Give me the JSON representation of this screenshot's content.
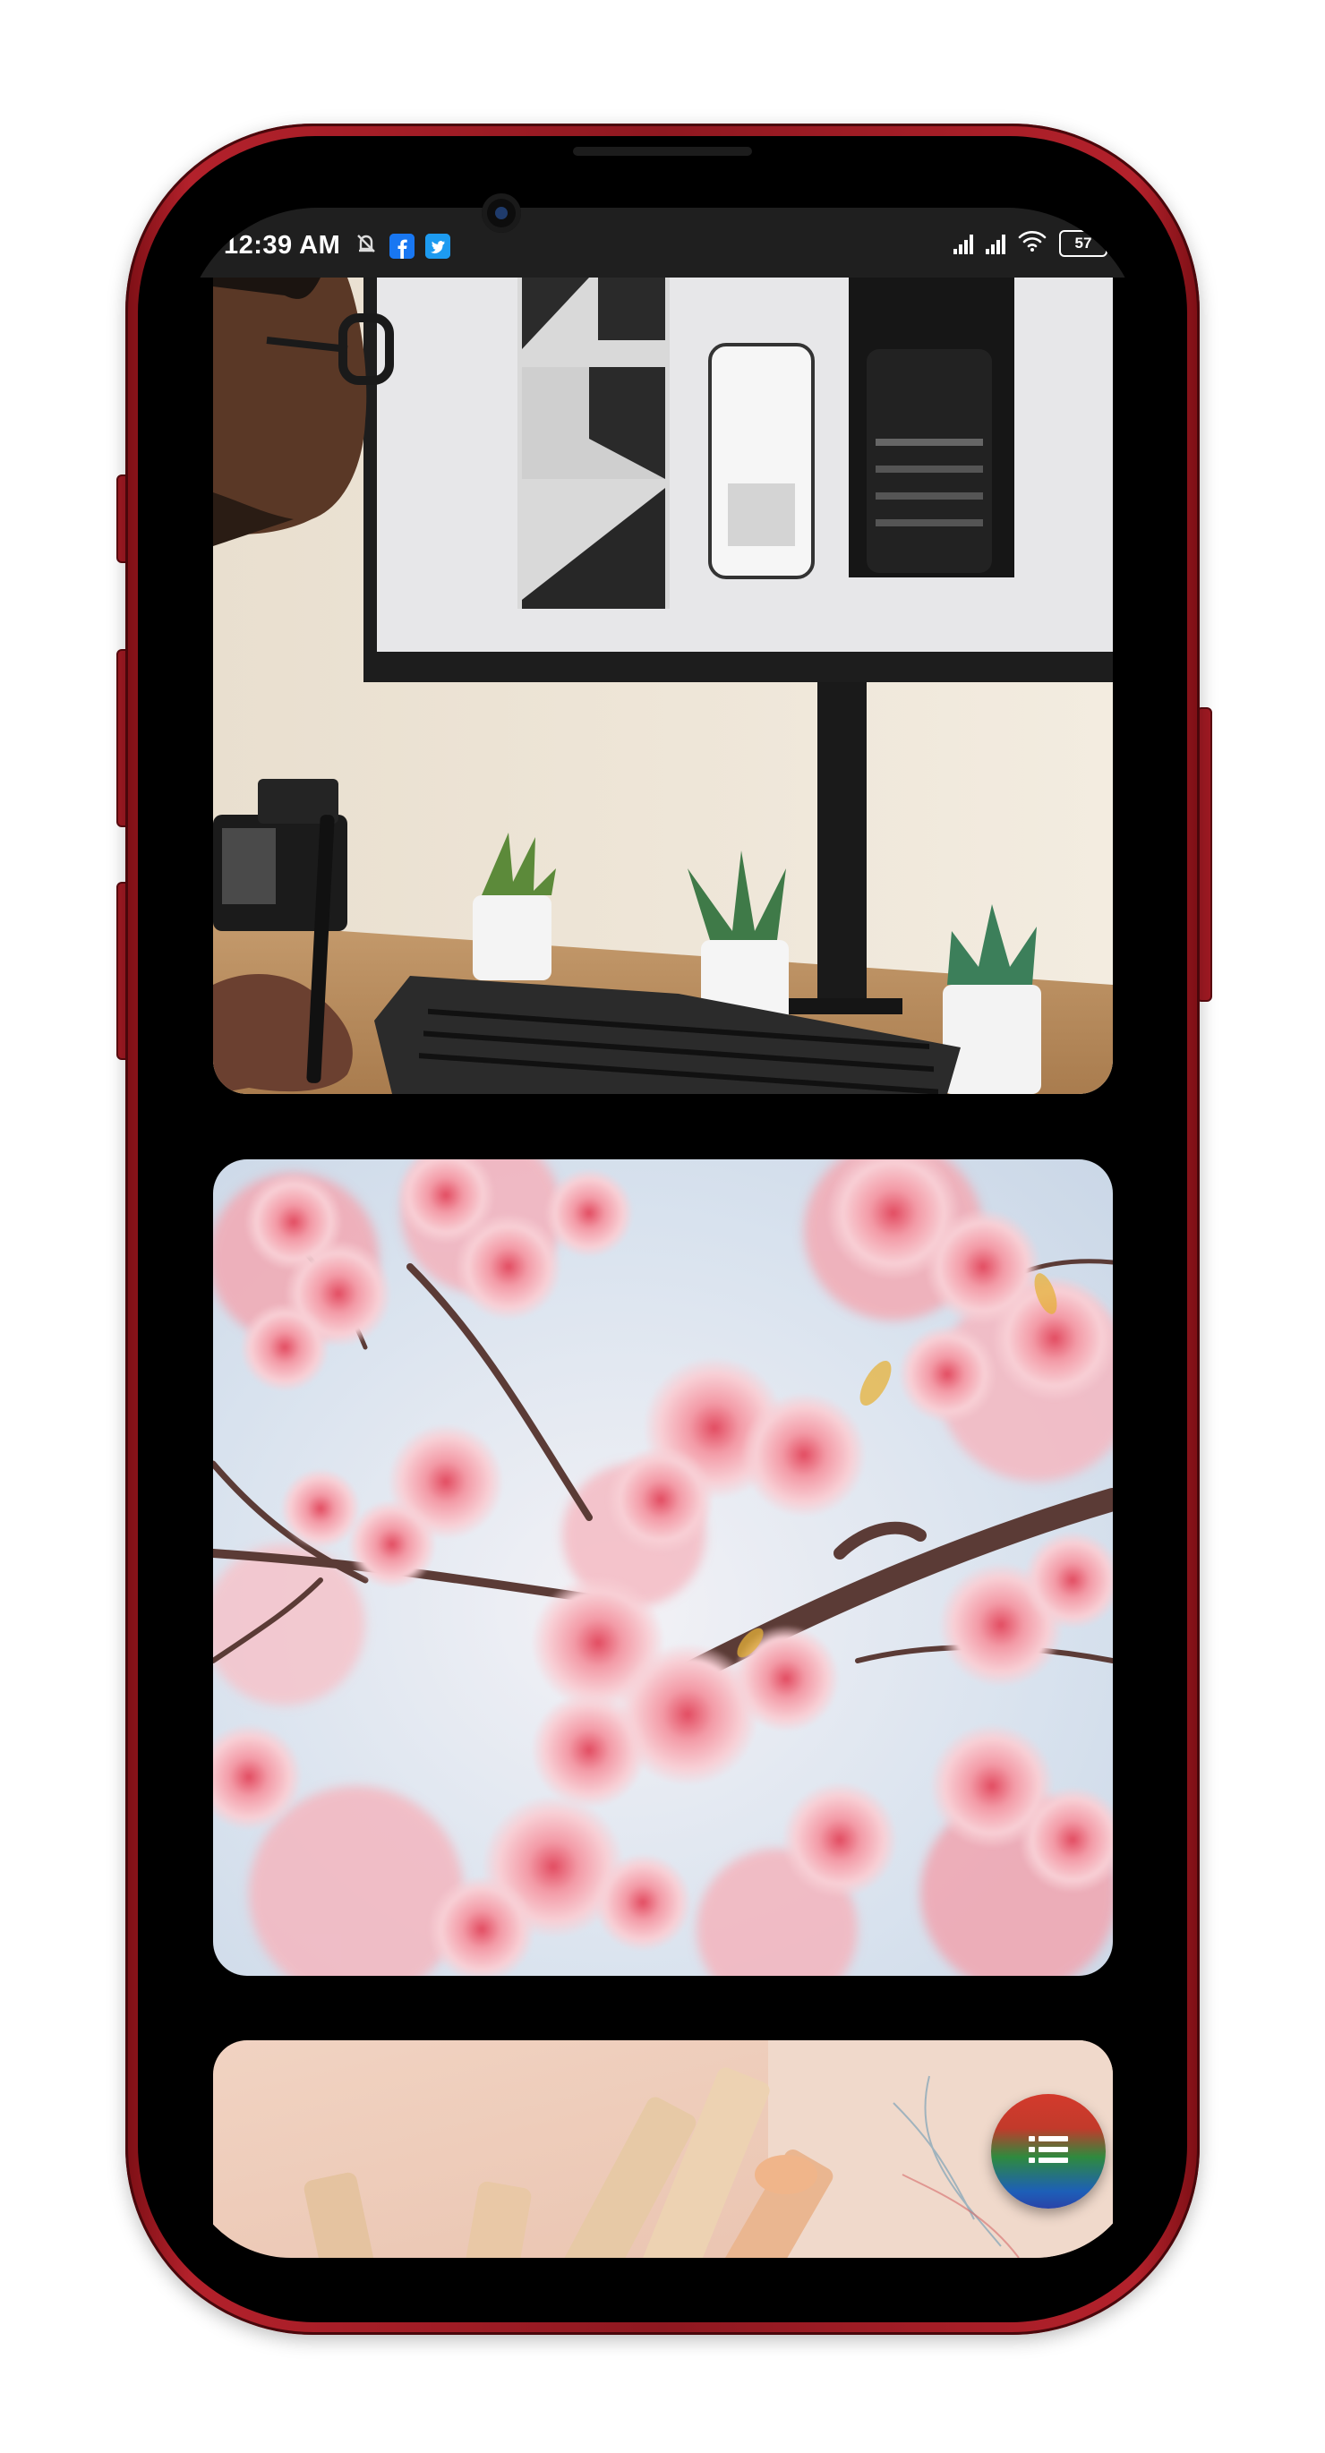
{
  "status_bar": {
    "time": "12:39 AM",
    "notification_icons": [
      "bell-off-icon",
      "facebook-icon",
      "twitter-icon"
    ],
    "battery_level": "57",
    "system_icons": [
      "signal-icon",
      "signal-icon",
      "wifi-icon",
      "battery-icon"
    ]
  },
  "feed": {
    "images": [
      {
        "description_icon": "photo-designer-at-monitor"
      },
      {
        "description_icon": "photo-cherry-blossoms"
      },
      {
        "description_icon": "photo-pastel-crayons"
      }
    ]
  },
  "fab": {
    "icon": "list-icon"
  },
  "colors": {
    "phone_frame": "#a11a23",
    "screen_bg": "#000000",
    "fab_top": "#d33a2c",
    "fab_mid": "#2f8a3e",
    "fab_bottom": "#1d5fb8"
  }
}
